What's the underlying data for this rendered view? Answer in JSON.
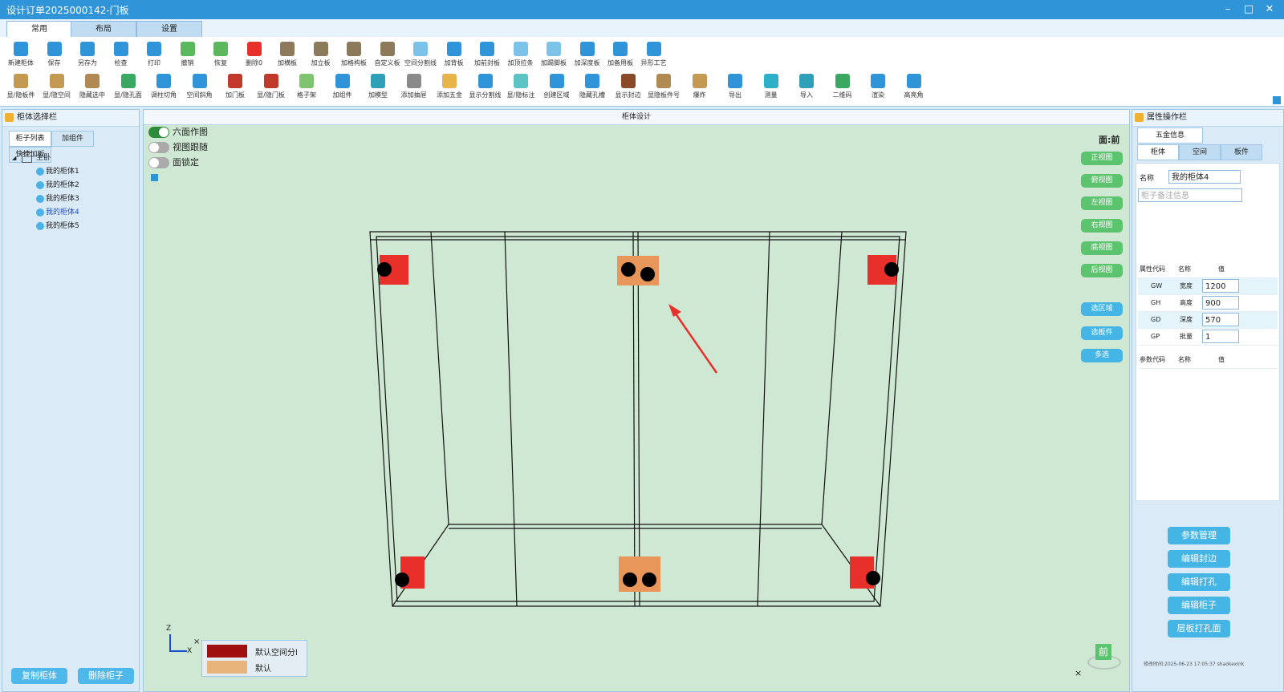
{
  "window": {
    "title": "设计订单2025000142-门板"
  },
  "tabs": [
    "常用",
    "布局",
    "设置"
  ],
  "toolbar_row1": [
    "新建柜体",
    "保存",
    "另存为",
    "检查",
    "打印",
    "撤销",
    "恢复",
    "删除0",
    "加横板",
    "加立板",
    "加格构板",
    "自定义板",
    "空间分割线",
    "加背板",
    "加前封板",
    "加顶拉条",
    "加踢脚板",
    "加深度板",
    "加备用板",
    "异形工艺"
  ],
  "toolbar_row2": [
    "显/隐板件",
    "显/隐空间",
    "隐藏选中",
    "显/隐孔面",
    "调柱切角",
    "空间斜角",
    "加门板",
    "显/隐门板",
    "格子架",
    "加组件",
    "加模型",
    "添加抽屉",
    "添加五金",
    "显示分割线",
    "显/隐标注",
    "创建区域",
    "隐藏孔槽",
    "显示封边",
    "显隐板件号",
    "爆炸",
    "导出",
    "测量",
    "导入",
    "二维码",
    "渲染",
    "高亮角"
  ],
  "left_panel": {
    "title": "柜体选择栏",
    "subtabs": [
      "柜子列表",
      "加组件",
      "快捷加板"
    ],
    "tree_root": "主卧",
    "tree_items": [
      "我的柜体1",
      "我的柜体2",
      "我的柜体3",
      "我的柜体4",
      "我的柜体5"
    ],
    "buttons": [
      "复制柜体",
      "删除柜子"
    ]
  },
  "center": {
    "title": "柜体设计",
    "toggles": [
      {
        "label": "六面作图",
        "on": true
      },
      {
        "label": "视图跟随",
        "on": false
      },
      {
        "label": "面锁定",
        "on": false
      }
    ],
    "face_label": "面:前",
    "view_buttons": [
      "正视图",
      "俯视图",
      "左视图",
      "右视图",
      "底视图",
      "后视图"
    ],
    "select_buttons": [
      "选区域",
      "选板件",
      "多选"
    ],
    "legend": [
      {
        "label": "默认空间分l",
        "color": "#a00f10"
      },
      {
        "label": "默认",
        "color": "#e8b47a"
      }
    ],
    "axis": {
      "z": "Z",
      "x": "X"
    },
    "compass": "前"
  },
  "right_panel": {
    "title": "属性操作栏",
    "tab_top": "五金信息",
    "tabs": [
      "柜体",
      "空间",
      "板件"
    ],
    "name_label": "名称",
    "name_value": "我的柜体4",
    "note_placeholder": "柜子备注信息",
    "attr_headers": [
      "属性代码",
      "名称",
      "值"
    ],
    "attrs": [
      {
        "code": "GW",
        "name": "宽度",
        "value": "1200"
      },
      {
        "code": "GH",
        "name": "高度",
        "value": "900"
      },
      {
        "code": "GD",
        "name": "深度",
        "value": "570"
      },
      {
        "code": "GP",
        "name": "批量",
        "value": "1"
      }
    ],
    "param_headers": [
      "参数代码",
      "名称",
      "值"
    ],
    "buttons": [
      "参数管理",
      "编辑封边",
      "编辑打孔",
      "编辑柜子",
      "层板打孔面"
    ],
    "footer": "修改时间:2025-06-23 17:05:37 shaokexink"
  }
}
